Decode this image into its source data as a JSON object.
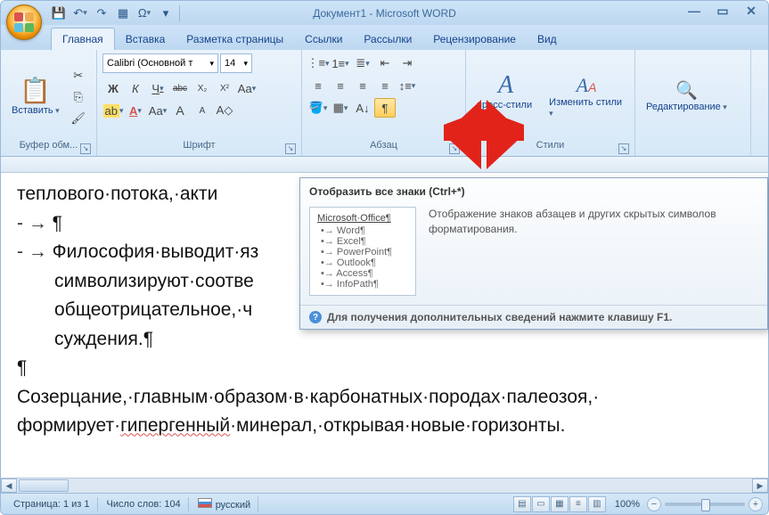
{
  "window": {
    "title": "Документ1 - Microsoft WORD"
  },
  "qat": {
    "save": "💾",
    "undo": "↶",
    "redo": "↷",
    "quick": "▦",
    "omega": "Ω"
  },
  "tabs": {
    "home": "Главная",
    "insert": "Вставка",
    "layout": "Разметка страницы",
    "refs": "Ссылки",
    "mail": "Рассылки",
    "review": "Рецензирование",
    "view": "Вид"
  },
  "ribbon": {
    "clipboard": {
      "label": "Буфер обм...",
      "paste": "Вставить"
    },
    "font": {
      "label": "Шрифт",
      "name": "Calibri (Основной т",
      "size": "14",
      "bold": "Ж",
      "italic": "К",
      "under": "Ч",
      "strike": "abc",
      "sub": "X₂",
      "sup": "X²",
      "case": "Aa",
      "grow": "A",
      "shrink": "A",
      "clear": "A"
    },
    "para": {
      "label": "Абзац"
    },
    "styles": {
      "label": "Стили",
      "quick": "пресс-стили",
      "change": "Изменить стили"
    },
    "editing": {
      "label": "Редактирование"
    }
  },
  "tooltip": {
    "title": "Отобразить все знаки (Ctrl+*)",
    "desc": "Отображение знаков абзацев и других скрытых символов форматирования.",
    "sample_title": "Microsoft·Office¶",
    "sample": [
      "•→ Word¶",
      "•→ Excel¶",
      "•→ PowerPoint¶",
      "•→ Outlook¶",
      "•→ Access¶",
      "•→ InfoPath¶"
    ],
    "footer": "Для получения дополнительных сведений нажмите клавишу F1."
  },
  "document": {
    "l1": "теплового·потока,·акти",
    "l2": "¶",
    "l3_a": "Философия·выводит·яз",
    "l4": "символизируют·соотве",
    "l5": "общеотрицательное,·ч",
    "l6": "суждения.¶",
    "l7": "¶",
    "l8_a": "Созерцание,·главным·образом·в·карбонатных·породах·палеозоя,·",
    "l9_a": "формирует·",
    "l9_b": "гипергенный",
    "l9_c": "·минерал,·открывая·новые·горизонты."
  },
  "status": {
    "page": "Страница: 1 из 1",
    "words": "Число слов: 104",
    "lang": "русский",
    "zoom": "100%"
  }
}
